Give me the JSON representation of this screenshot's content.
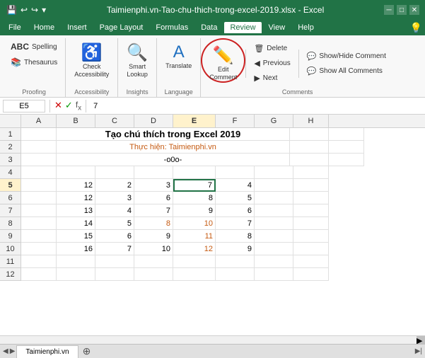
{
  "titlebar": {
    "title": "Taimienphi.vn-Tao-chu-thich-trong-excel-2019.xlsx - Excel",
    "save_icon": "💾",
    "undo_icon": "↩",
    "redo_icon": "↪"
  },
  "menubar": {
    "items": [
      "File",
      "Home",
      "Insert",
      "Page Layout",
      "Formulas",
      "Data",
      "Review",
      "View",
      "Help"
    ]
  },
  "ribbon": {
    "groups": [
      {
        "name": "Proofing",
        "buttons": [
          {
            "label": "Spelling",
            "icon": "ABC"
          },
          {
            "label": "Thesaurus",
            "icon": "📖"
          }
        ]
      },
      {
        "name": "Accessibility",
        "buttons": [
          {
            "label": "Check\nAccessibility",
            "icon": "♿"
          }
        ]
      },
      {
        "name": "Insights",
        "buttons": [
          {
            "label": "Smart\nLookup",
            "icon": "🔍"
          }
        ]
      },
      {
        "name": "Language",
        "buttons": [
          {
            "label": "Translate",
            "icon": "A→"
          }
        ]
      },
      {
        "name": "Comments",
        "edit_comment_label": "Edit\nComment",
        "delete_label": "Delete",
        "previous_label": "Previous",
        "next_label": "Next",
        "show_hide_label": "Show/Hide Comment",
        "show_all_label": "Show All Comments"
      }
    ]
  },
  "formula_bar": {
    "cell_ref": "E5",
    "value": "7"
  },
  "columns": {
    "headers": [
      "",
      "A",
      "B",
      "C",
      "D",
      "E",
      "F",
      "G",
      "H"
    ],
    "widths": [
      30,
      50,
      55,
      55,
      55,
      60,
      55,
      55,
      50
    ]
  },
  "rows": [
    {
      "num": "1",
      "cells": [
        "",
        "",
        "",
        "",
        "",
        "",
        "",
        ""
      ]
    },
    {
      "num": "2",
      "cells": [
        "",
        "",
        "",
        "",
        "",
        "",
        "",
        ""
      ]
    },
    {
      "num": "3",
      "cells": [
        "",
        "",
        "",
        "",
        "",
        "",
        "",
        ""
      ]
    },
    {
      "num": "4",
      "cells": [
        "",
        "",
        "",
        "",
        "",
        "",
        "",
        ""
      ]
    },
    {
      "num": "5",
      "cells": [
        "",
        "12",
        "2",
        "3",
        "7",
        "4",
        "",
        ""
      ]
    },
    {
      "num": "6",
      "cells": [
        "",
        "12",
        "3",
        "6",
        "8",
        "5",
        "",
        ""
      ]
    },
    {
      "num": "7",
      "cells": [
        "",
        "13",
        "4",
        "7",
        "9",
        "6",
        "",
        ""
      ]
    },
    {
      "num": "8",
      "cells": [
        "",
        "14",
        "5",
        "8",
        "10",
        "7",
        "",
        ""
      ]
    },
    {
      "num": "9",
      "cells": [
        "",
        "15",
        "6",
        "9",
        "11",
        "8",
        "",
        ""
      ]
    },
    {
      "num": "10",
      "cells": [
        "",
        "16",
        "7",
        "10",
        "12",
        "9",
        "",
        ""
      ]
    },
    {
      "num": "11",
      "cells": [
        "",
        "",
        "",
        "",
        "",
        "",
        "",
        ""
      ]
    },
    {
      "num": "12",
      "cells": [
        "",
        "",
        "",
        "",
        "",
        "",
        "",
        ""
      ]
    }
  ],
  "special_cells": {
    "title_row": 1,
    "title_text": "Tạo chú thích trong Excel 2019",
    "subtitle_row": 2,
    "subtitle_text": "Thực hiện: Taimienphi.vn",
    "divider_row": 3,
    "divider_text": "-o0o-"
  },
  "sheet_tab": {
    "name": "Taimienphi.vn"
  },
  "active_cell": {
    "row": 5,
    "col": 4
  }
}
